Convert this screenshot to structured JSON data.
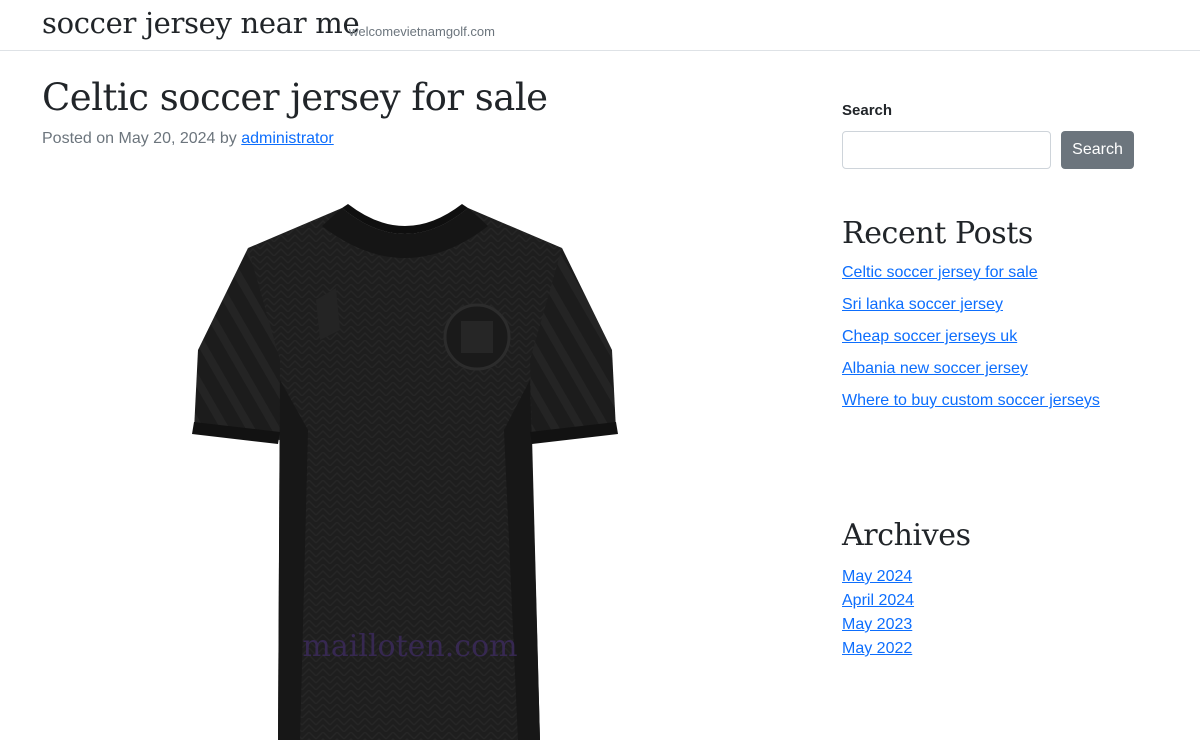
{
  "header": {
    "site_title": "soccer jersey near me",
    "site_description": "welcomevietnamgolf.com"
  },
  "post": {
    "title": "Celtic soccer jersey for sale",
    "meta_prefix": "Posted on May 20, 2024 by ",
    "author": "administrator",
    "image": {
      "watermark": "mailloten.com",
      "colors": {
        "shirt": "#1e1e1e",
        "shirt_dark": "#141414",
        "shirt_light": "#2a2a2a"
      }
    }
  },
  "sidebar": {
    "search": {
      "label": "Search",
      "input_value": "",
      "button_label": "Search"
    },
    "recent_posts": {
      "title": "Recent Posts",
      "items": [
        "Celtic soccer jersey for sale",
        "Sri lanka soccer jersey",
        "Cheap soccer jerseys uk",
        "Albania new soccer jersey",
        "Where to buy custom soccer jerseys"
      ]
    },
    "archives": {
      "title": "Archives",
      "items": [
        "May 2024",
        "April 2024",
        "May 2023",
        "May 2022"
      ]
    }
  },
  "colors": {
    "link": "#0d6efd",
    "button_bg": "#6c757d",
    "text": "#212529",
    "muted": "#6c757d"
  }
}
